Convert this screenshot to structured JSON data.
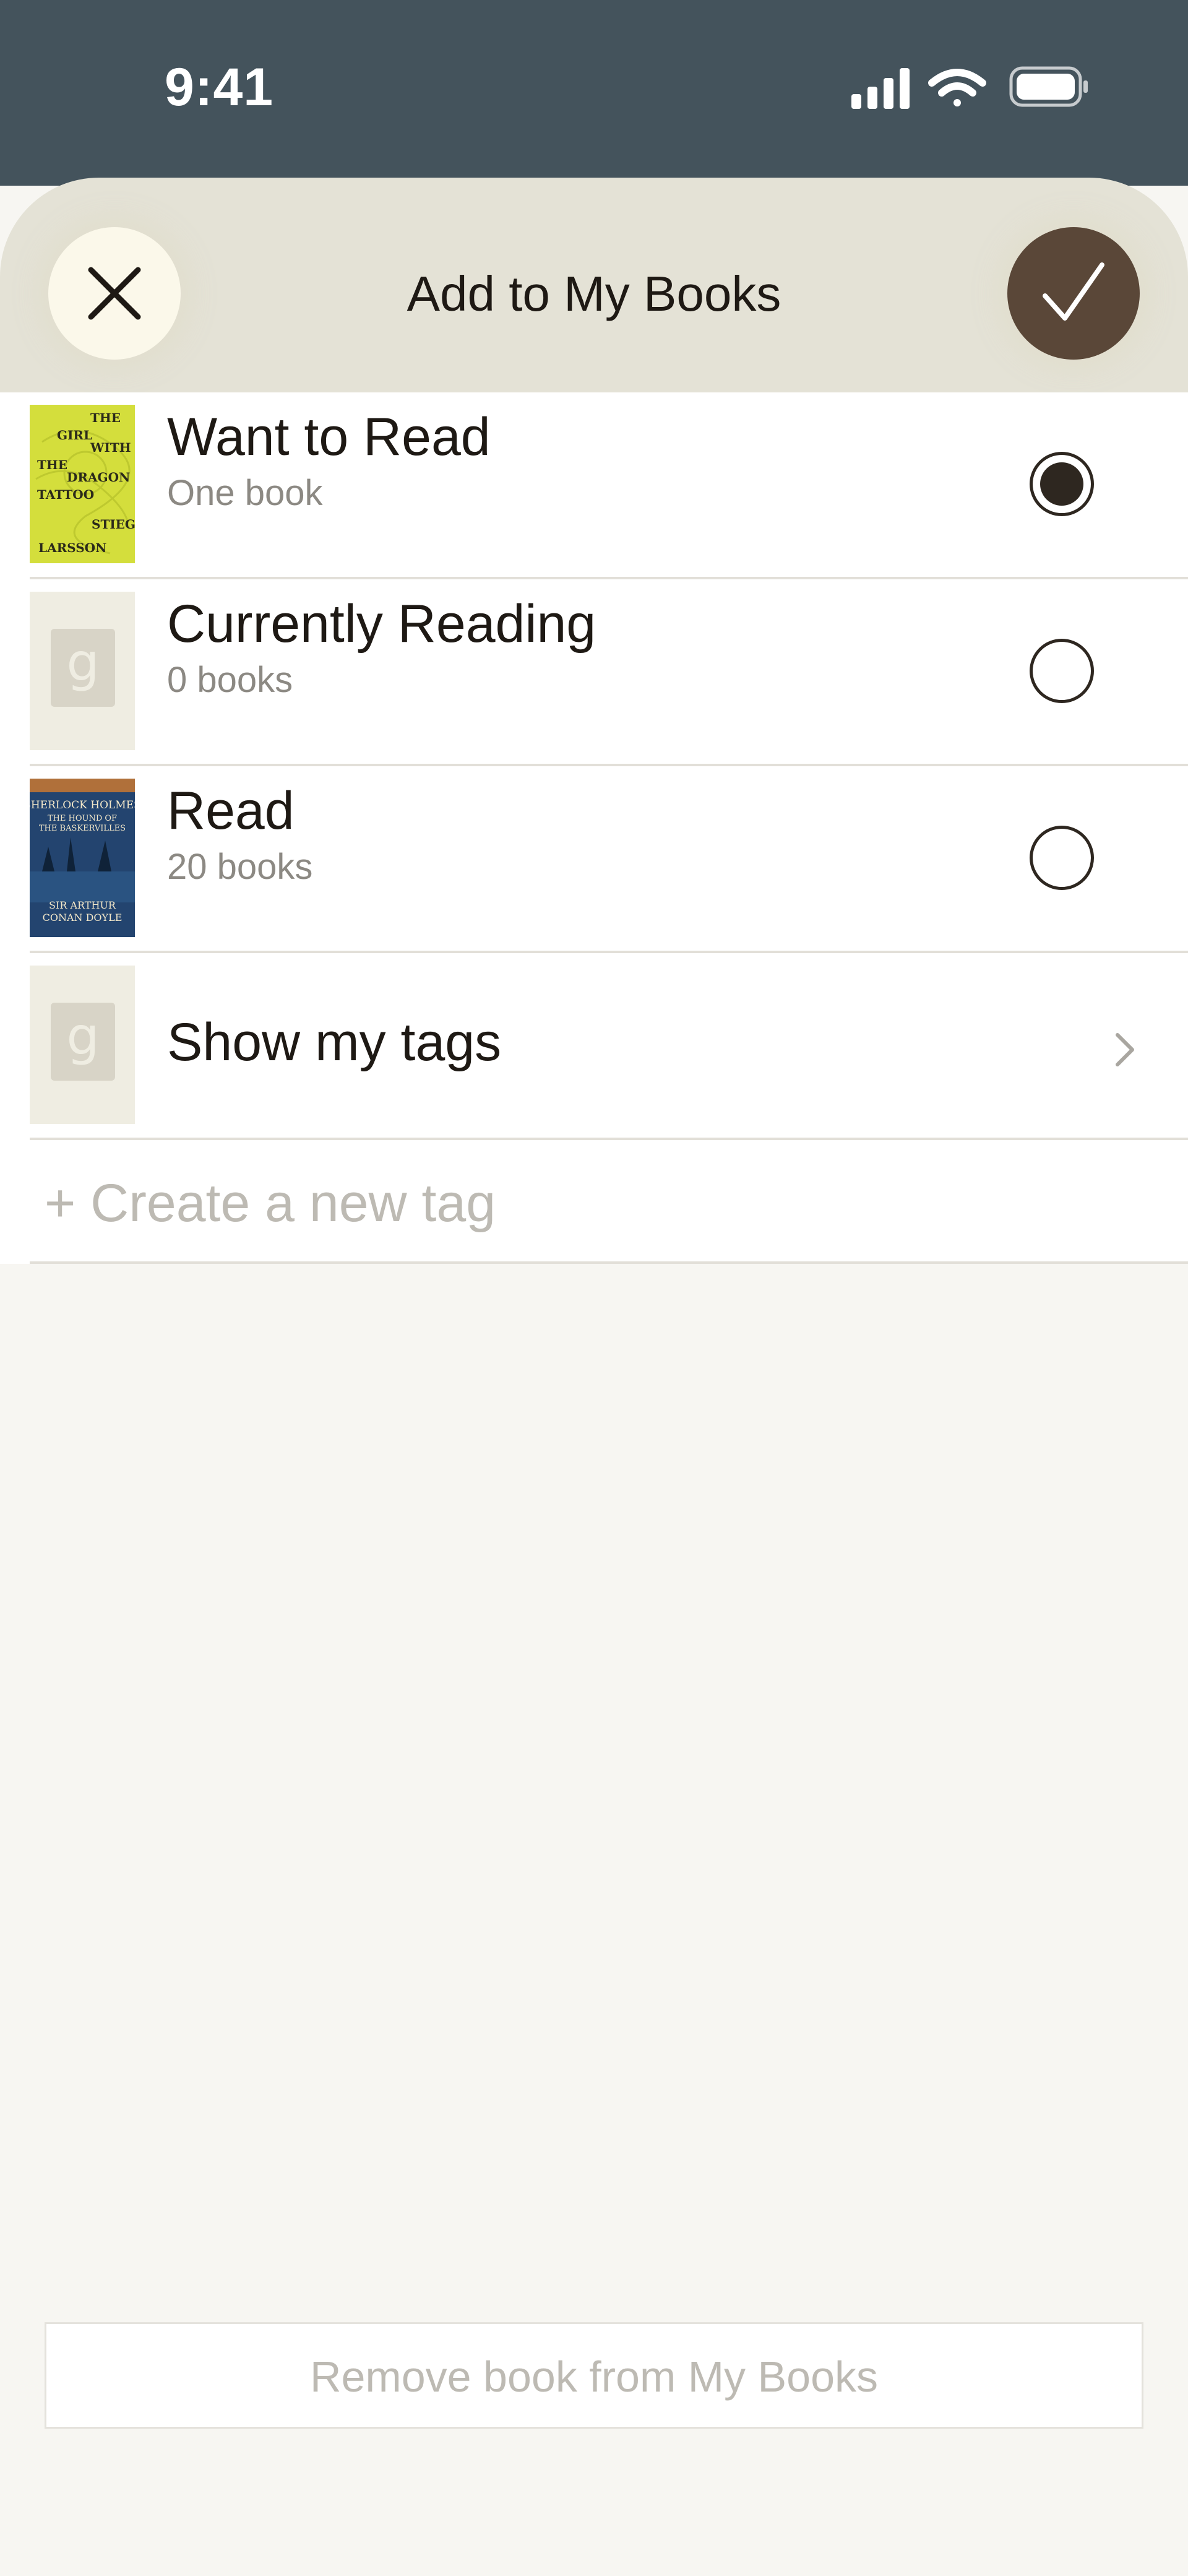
{
  "status_bar": {
    "time": "9:41"
  },
  "header": {
    "title": "Add to My Books",
    "close_icon": "close-icon",
    "confirm_icon": "checkmark-icon"
  },
  "shelves": [
    {
      "title": "Want to Read",
      "subtitle": "One book",
      "selected": true,
      "cover": "The Girl with the Dragon Tattoo cover"
    },
    {
      "title": "Currently Reading",
      "subtitle": "0 books",
      "selected": false,
      "cover": "placeholder"
    },
    {
      "title": "Read",
      "subtitle": "20 books",
      "selected": false,
      "cover": "Sherlock Holmes cover"
    }
  ],
  "tags_row": {
    "title": "Show my tags"
  },
  "create_tag": {
    "label": "+ Create a new tag"
  },
  "remove_button": {
    "label": "Remove book from My Books"
  },
  "covers": {
    "dragon_tattoo": {
      "lines": [
        "THE",
        "GIRL",
        "WITH",
        "THE",
        "DRAGON",
        "TATTOO",
        "STIEG",
        "LARSSON"
      ]
    },
    "sherlock": {
      "lines": [
        "SHERLOCK HOLMES",
        "THE HOUND OF",
        "THE BASKERVILLES",
        "SIR ARTHUR",
        "CONAN DOYLE"
      ]
    }
  },
  "colors": {
    "accent_dark": "#5A4738",
    "header_bg": "#E4E2D6",
    "status_bg": "#44535C"
  }
}
